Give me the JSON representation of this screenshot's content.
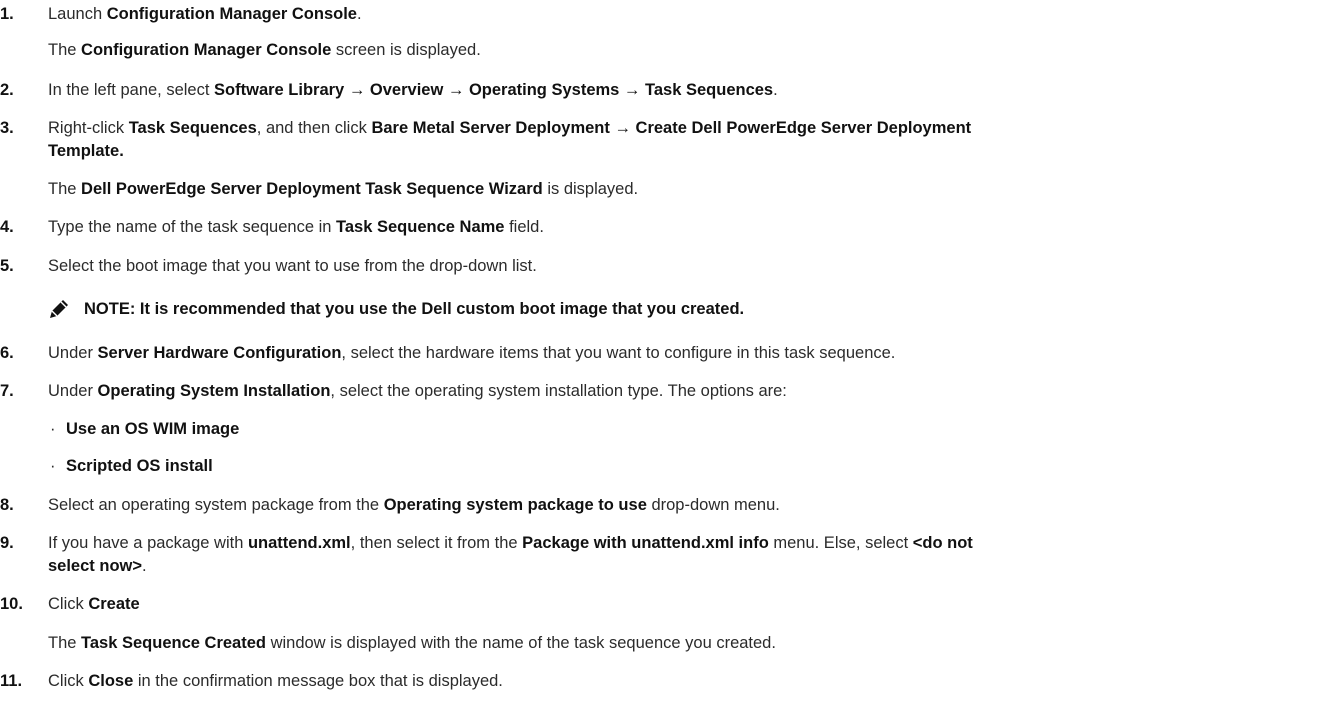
{
  "steps": [
    {
      "n": "1.",
      "parts": [
        [
          "Launch ",
          false
        ],
        [
          "Configuration Manager Console",
          true
        ],
        [
          ".",
          false
        ]
      ]
    },
    {
      "sub": true,
      "parts": [
        [
          "The ",
          false
        ],
        [
          "Configuration Manager Console",
          true
        ],
        [
          " screen is displayed.",
          false
        ]
      ]
    },
    {
      "n": "2.",
      "parts": [
        [
          "In the left pane, select ",
          false
        ],
        [
          "Software Library → Overview → Operating Systems → Task Sequences",
          true
        ],
        [
          ".",
          false
        ]
      ]
    },
    {
      "n": "3.",
      "parts": [
        [
          "Right-click ",
          false
        ],
        [
          "Task Sequences",
          true
        ],
        [
          ", and then click ",
          false
        ],
        [
          "Bare Metal Server Deployment → Create Dell PowerEdge Server Deployment",
          true
        ]
      ]
    },
    {
      "sub": true,
      "parts": [
        [
          "Template.",
          true
        ]
      ]
    },
    {
      "sub": true,
      "parts": [
        [
          "The ",
          false
        ],
        [
          "Dell PowerEdge Server Deployment Task Sequence Wizard",
          true
        ],
        [
          " is displayed.",
          false
        ]
      ]
    },
    {
      "n": "4.",
      "parts": [
        [
          "Type the name of the task sequence in ",
          false
        ],
        [
          "Task Sequence Name",
          true
        ],
        [
          " field.",
          false
        ]
      ]
    },
    {
      "n": "5.",
      "parts": [
        [
          "Select the boot image that you want to use from the drop-down list.",
          false
        ]
      ]
    },
    {
      "note": true,
      "parts": [
        [
          "NOTE: It is recommended that you use the Dell custom boot image that you created.",
          true
        ]
      ]
    },
    {
      "n": "6.",
      "parts": [
        [
          "Under ",
          false
        ],
        [
          "Server Hardware Configuration",
          true
        ],
        [
          ", select the hardware items that you want to configure in this task sequence.",
          false
        ]
      ]
    },
    {
      "n": "7.",
      "parts": [
        [
          "Under ",
          false
        ],
        [
          "Operating System Installation",
          true
        ],
        [
          ", select the operating system installation type. The options are:",
          false
        ]
      ]
    },
    {
      "bullet": true,
      "parts": [
        [
          "Use an OS WIM image",
          true
        ]
      ]
    },
    {
      "bullet": true,
      "parts": [
        [
          "Scripted OS install",
          true
        ]
      ]
    },
    {
      "n": "8.",
      "parts": [
        [
          "Select an operating system package from the ",
          false
        ],
        [
          "Operating system package to use",
          true
        ],
        [
          " drop-down menu.",
          false
        ]
      ]
    },
    {
      "n": "9.",
      "parts": [
        [
          "If you have a package with ",
          false
        ],
        [
          "unattend.xml",
          true
        ],
        [
          ", then select it from the ",
          false
        ],
        [
          "Package with unattend.xml info",
          true
        ],
        [
          " menu. Else, select ",
          false
        ],
        [
          "<do not",
          true
        ]
      ]
    },
    {
      "sub": true,
      "parts": [
        [
          "select now>",
          true
        ],
        [
          ".",
          false
        ]
      ]
    },
    {
      "n": "10.",
      "parts": [
        [
          "Click ",
          false
        ],
        [
          "Create",
          true
        ]
      ]
    },
    {
      "sub": true,
      "parts": [
        [
          "The ",
          false
        ],
        [
          "Task Sequence Created",
          true
        ],
        [
          " window is displayed with the name of the task sequence you created.",
          false
        ]
      ]
    },
    {
      "n": "11.",
      "parts": [
        [
          "Click ",
          false
        ],
        [
          "Close",
          true
        ],
        [
          " in the confirmation message box that is displayed.",
          false
        ]
      ]
    }
  ]
}
